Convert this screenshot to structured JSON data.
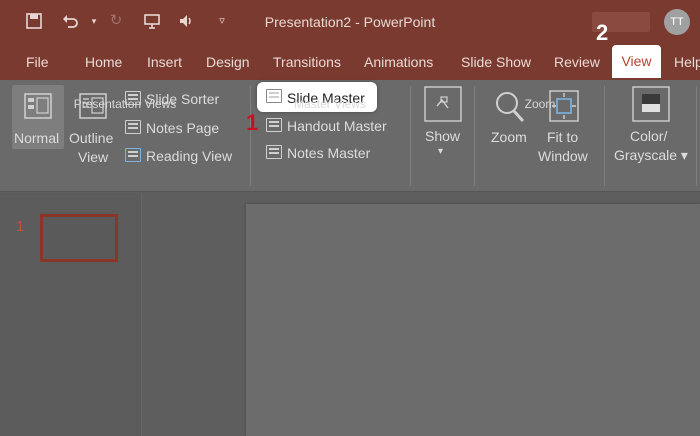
{
  "window": {
    "title": "Presentation2  -  PowerPoint",
    "user_initials": "TT"
  },
  "tabs": [
    "File",
    "Home",
    "Insert",
    "Design",
    "Transitions",
    "Animations",
    "Slide Show",
    "Review",
    "View",
    "Help"
  ],
  "ribbon": {
    "presentation_views": {
      "label": "Presentation Views",
      "normal": "Normal",
      "outline_view_1": "Outline",
      "outline_view_2": "View",
      "slide_sorter": "Slide Sorter",
      "notes_page": "Notes Page",
      "reading_view": "Reading View"
    },
    "master_views": {
      "label": "Master Views",
      "slide_master": "Slide Master",
      "handout_master": "Handout Master",
      "notes_master": "Notes Master"
    },
    "show": {
      "label": "Show",
      "arrow": "▾"
    },
    "zoom": {
      "label": "Zoom",
      "zoom": "Zoom",
      "fit_1": "Fit to",
      "fit_2": "Window"
    },
    "color": {
      "line1": "Color/",
      "line2": "Grayscale ▾"
    }
  },
  "annotations": {
    "step1": "1",
    "step2": "2"
  },
  "slides": {
    "current_number": "1"
  },
  "colors": {
    "accent": "#b9422f",
    "titlebar": "#7a3a30",
    "marker": "#c6101f"
  }
}
